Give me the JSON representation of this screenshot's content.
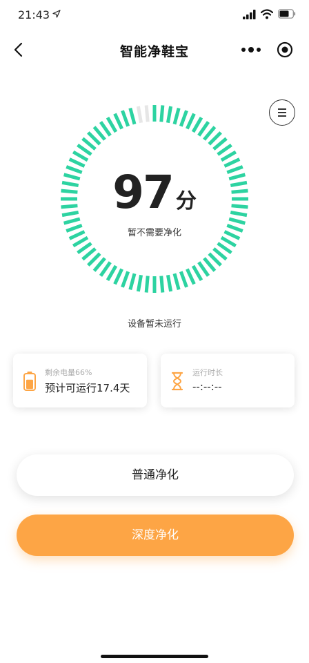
{
  "status_bar": {
    "time": "21:43"
  },
  "nav": {
    "title": "智能净鞋宝"
  },
  "score": {
    "value": "97",
    "unit": "分",
    "fraction": 0.97,
    "status": "暂不需要净化"
  },
  "device_status": "设备暂未运行",
  "cards": {
    "battery": {
      "label": "剩余电量66%",
      "value": "预计可运行17.4天",
      "level": 0.66
    },
    "runtime": {
      "label": "运行时长",
      "value": "--:--:--"
    }
  },
  "buttons": {
    "normal": "普通净化",
    "deep": "深度净化"
  },
  "colors": {
    "accent_green": "#2dd3a1",
    "accent_orange": "#fda545"
  },
  "icons": [
    "location-arrow-icon",
    "signal-icon",
    "wifi-icon",
    "battery-icon",
    "back-icon",
    "more-icon",
    "close-circle-icon",
    "menu-icon",
    "battery-level-icon",
    "hourglass-icon"
  ]
}
